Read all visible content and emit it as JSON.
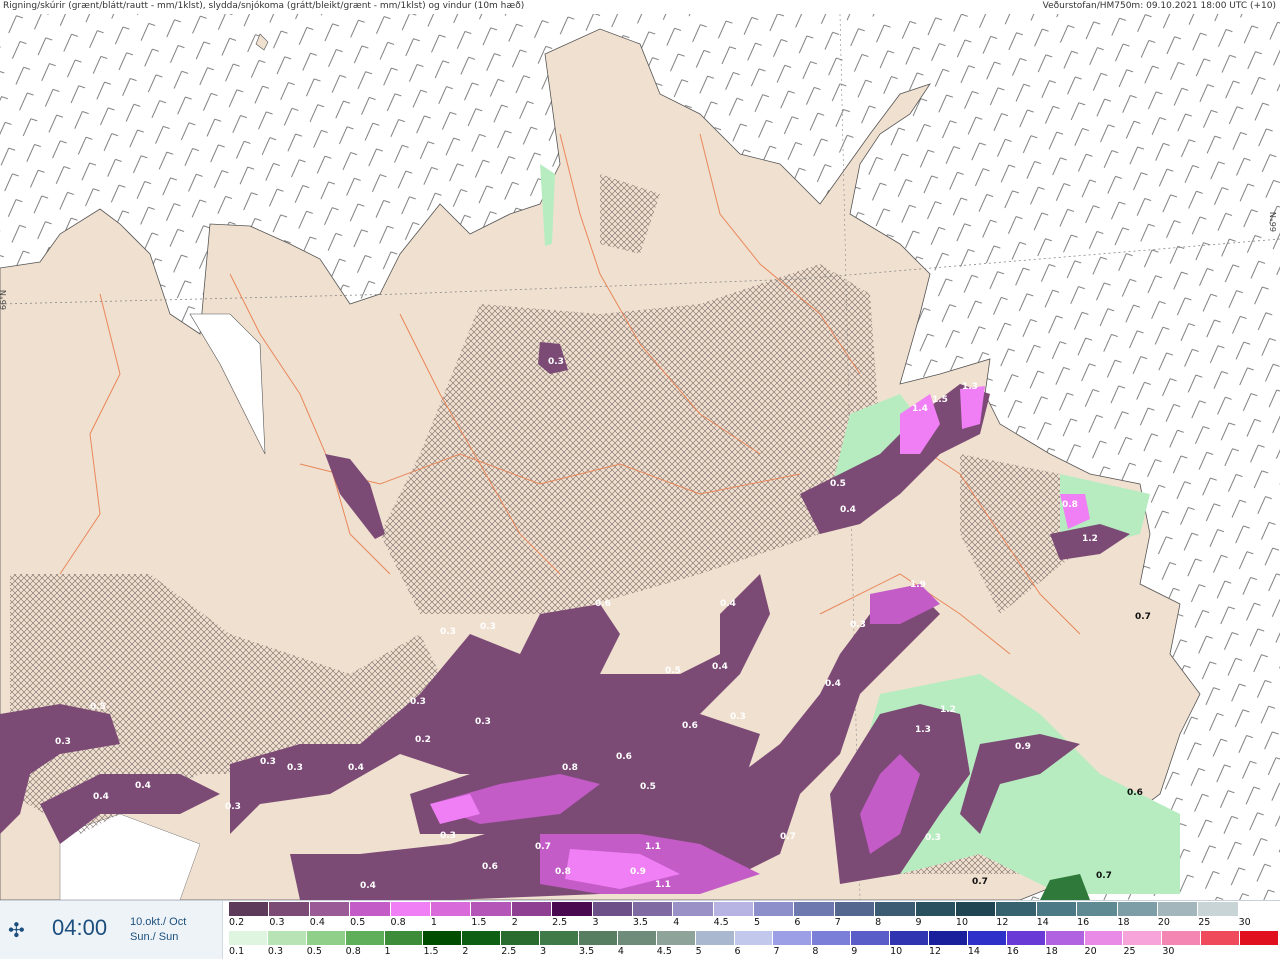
{
  "header": {
    "title": "Rigning/skúrir (grænt/blátt/rautt - mm/1klst), slydda/snjókoma (grátt/bleikt/grænt - mm/1klst) og vindur (10m hæð)",
    "source": "Veðurstofan/HM750m: 09.10.2021 18:00 UTC (+10)"
  },
  "map": {
    "latitude_label_left": "66°N",
    "latitude_label_right": "66°N",
    "colors": {
      "sea": "#ffffff",
      "land": "#f0e0d0",
      "roads": "#e8875a",
      "snow_light": "#7b4a75",
      "snow_mid": "#c45cc8",
      "snow_heavy": "#f07ef5",
      "rain_light": "#b7ecc0",
      "rain_dark": "#2f7a3a"
    },
    "precip_values": [
      {
        "v": "0.3"
      },
      {
        "v": "0.3"
      },
      {
        "v": "0.6"
      },
      {
        "v": "0.4"
      },
      {
        "v": "0.3"
      },
      {
        "v": "0.5"
      },
      {
        "v": "0.4"
      },
      {
        "v": "1.5"
      },
      {
        "v": "1.3"
      },
      {
        "v": "1.4"
      },
      {
        "v": "0.8"
      },
      {
        "v": "1.2"
      },
      {
        "v": "0.7"
      },
      {
        "v": "1.9"
      },
      {
        "v": "0.3"
      },
      {
        "v": "0.4"
      },
      {
        "v": "0.5"
      },
      {
        "v": "0.4"
      },
      {
        "v": "0.3"
      },
      {
        "v": "0.3"
      },
      {
        "v": "0.6"
      },
      {
        "v": "0.8"
      },
      {
        "v": "0.6"
      },
      {
        "v": "0.5"
      },
      {
        "v": "0.7"
      },
      {
        "v": "0.3"
      },
      {
        "v": "0.4"
      },
      {
        "v": "0.3"
      },
      {
        "v": "0.4"
      },
      {
        "v": "0.3"
      },
      {
        "v": "0.5"
      },
      {
        "v": "0.3"
      },
      {
        "v": "0.3"
      },
      {
        "v": "0.4"
      },
      {
        "v": "0.3"
      },
      {
        "v": "0.4"
      },
      {
        "v": "0.6"
      },
      {
        "v": "0.7"
      },
      {
        "v": "1.1"
      },
      {
        "v": "1.1"
      },
      {
        "v": "0.8"
      },
      {
        "v": "0.9"
      },
      {
        "v": "1.2"
      },
      {
        "v": "1.3"
      },
      {
        "v": "0.9"
      },
      {
        "v": "0.6"
      },
      {
        "v": "0.7"
      },
      {
        "v": "0.7"
      },
      {
        "v": "0.2"
      },
      {
        "v": "0.3"
      }
    ]
  },
  "footer": {
    "time": "04:00",
    "date_line1": "10.okt./ Oct",
    "date_line2": "Sun./ Sun",
    "snow_scale": {
      "colors": [
        "#5e3a5a",
        "#7b4a75",
        "#9a5a95",
        "#c45cc8",
        "#f07ef5",
        "#d86ad9",
        "#b455b8",
        "#8e3f92",
        "#4a0a4f",
        "#6c5087",
        "#7f6ba2",
        "#9a91c7",
        "#b7b3e3",
        "#8c8fc9",
        "#6e79b0",
        "#54678e",
        "#3c5c74",
        "#28505e",
        "#1f4553",
        "#36626f",
        "#4b7a86",
        "#5f8a94",
        "#7d9ea6",
        "#a3b6bc",
        "#c9d4d7",
        "#ffffff"
      ],
      "labels": [
        "0.2",
        "0.3",
        "0.4",
        "0.5",
        "0.8",
        "1",
        "1.5",
        "2",
        "2.5",
        "3",
        "3.5",
        "4",
        "4.5",
        "5",
        "6",
        "7",
        "8",
        "9",
        "10",
        "12",
        "14",
        "16",
        "18",
        "20",
        "25",
        "30"
      ]
    },
    "rain_scale": {
      "colors": [
        "#dff5df",
        "#b7e3b5",
        "#8fcf8a",
        "#5fae5a",
        "#3d8c3a",
        "#004d00",
        "#0e5f14",
        "#2a6b30",
        "#3f7a48",
        "#587e62",
        "#6f8c7b",
        "#8ea39a",
        "#a9b7cf",
        "#c2c7ec",
        "#9d9fe6",
        "#7c7fd8",
        "#5a5cc8",
        "#3134b0",
        "#1a1f9b",
        "#2e30c9",
        "#6a3ad6",
        "#b062e0",
        "#e88ae6",
        "#f6a4da",
        "#f486b4",
        "#ee4a5c",
        "#e0101e"
      ],
      "labels": [
        "0.1",
        "0.3",
        "0.5",
        "0.8",
        "1",
        "1.5",
        "2",
        "2.5",
        "3",
        "3.5",
        "4",
        "4.5",
        "5",
        "6",
        "7",
        "8",
        "9",
        "10",
        "12",
        "14",
        "16",
        "18",
        "20",
        "25",
        "30"
      ]
    }
  }
}
